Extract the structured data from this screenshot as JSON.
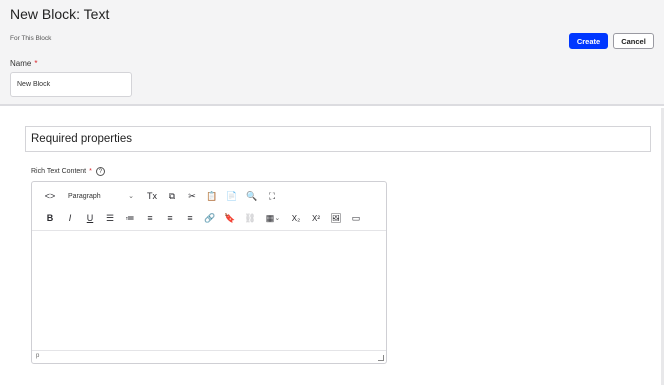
{
  "header": {
    "title": "New Block: Text",
    "subtitle": "For This Block",
    "create_label": "Create",
    "cancel_label": "Cancel",
    "name_label": "Name",
    "required_marker": "*",
    "name_value": "New Block"
  },
  "section": {
    "title": "Required properties"
  },
  "rich_text": {
    "label": "Rich Text Content",
    "required_marker": "*",
    "help_glyph": "?",
    "format_select": "Paragraph",
    "status_path": "p",
    "toolbar_row1": [
      {
        "name": "source-code-icon",
        "glyph": "<>"
      },
      {
        "name": "clear-format-icon",
        "glyph": "Tx"
      },
      {
        "name": "copy-icon",
        "glyph": "⧉"
      },
      {
        "name": "cut-icon",
        "glyph": "✂"
      },
      {
        "name": "paste-icon",
        "glyph": "📋"
      },
      {
        "name": "paste-text-icon",
        "glyph": "📄"
      },
      {
        "name": "find-icon",
        "glyph": "🔍"
      },
      {
        "name": "fullscreen-icon",
        "glyph": "⛶"
      }
    ],
    "toolbar_row2": [
      {
        "name": "bold-icon",
        "glyph": "B"
      },
      {
        "name": "italic-icon",
        "glyph": "I"
      },
      {
        "name": "underline-icon",
        "glyph": "U"
      },
      {
        "name": "bullet-list-icon",
        "glyph": "☰"
      },
      {
        "name": "numbered-list-icon",
        "glyph": "≔"
      },
      {
        "name": "align-left-icon",
        "glyph": "≡"
      },
      {
        "name": "align-center-icon",
        "glyph": "≡"
      },
      {
        "name": "align-right-icon",
        "glyph": "≡"
      },
      {
        "name": "link-icon",
        "glyph": "🔗"
      },
      {
        "name": "bookmark-icon",
        "glyph": "🔖"
      },
      {
        "name": "unlink-icon",
        "glyph": "⛓"
      },
      {
        "name": "table-icon",
        "glyph": "▦"
      },
      {
        "name": "subscript-icon",
        "glyph": "X₂"
      },
      {
        "name": "superscript-icon",
        "glyph": "X²"
      },
      {
        "name": "image-icon",
        "glyph": "🖼"
      },
      {
        "name": "media-icon",
        "glyph": "▭"
      }
    ]
  },
  "colors": {
    "primary": "#0037ff",
    "required": "#d9262c",
    "header_bg": "#f4f4f5"
  }
}
